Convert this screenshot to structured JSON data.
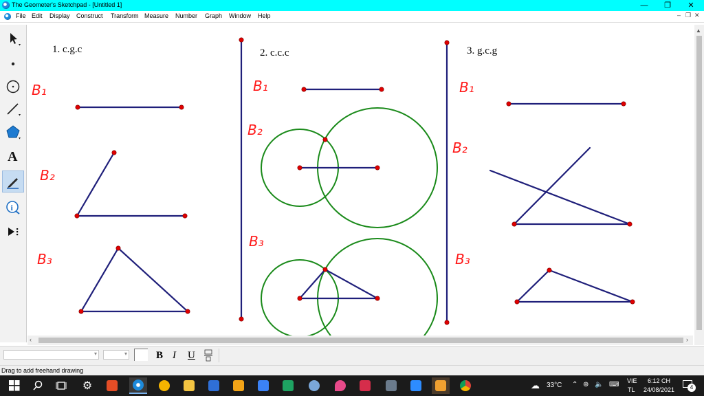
{
  "window": {
    "title": "The Geometer's Sketchpad - [Untitled 1]",
    "controls": [
      "—",
      "❐",
      "✕"
    ]
  },
  "menu": [
    "File",
    "Edit",
    "Display",
    "Construct",
    "Transform",
    "Measure",
    "Number",
    "Graph",
    "Window",
    "Help"
  ],
  "mdi_controls": [
    "–",
    "❐",
    "✕"
  ],
  "tools": [
    "arrow-select",
    "point",
    "compass",
    "straightedge",
    "polygon",
    "text",
    "marker",
    "information",
    "custom"
  ],
  "canvas": {
    "headings": [
      "1. c.g.c",
      "2. c.c.c",
      "3. g.c.g"
    ],
    "step_labels": {
      "col1": [
        "B₁",
        "B₂",
        "B₃"
      ],
      "col2": [
        "B₁",
        "B₂",
        "B₃"
      ],
      "col3": [
        "B₁",
        "B₂",
        "B₃"
      ]
    },
    "colors": {
      "segment": "#1f1f7a",
      "point": "#e00000",
      "circle": "#1a8a1a",
      "label": "#ff1a1a"
    }
  },
  "stylebar": {
    "bold": "B",
    "italic": "I",
    "underline": "U",
    "math": "fraction"
  },
  "status": "Drag to add freehand drawing",
  "taskbar": {
    "temperature": "33°C",
    "lang": [
      "VIE",
      "TL"
    ],
    "time": "6:12 CH",
    "date": "24/08/2021",
    "notifications": "4"
  }
}
